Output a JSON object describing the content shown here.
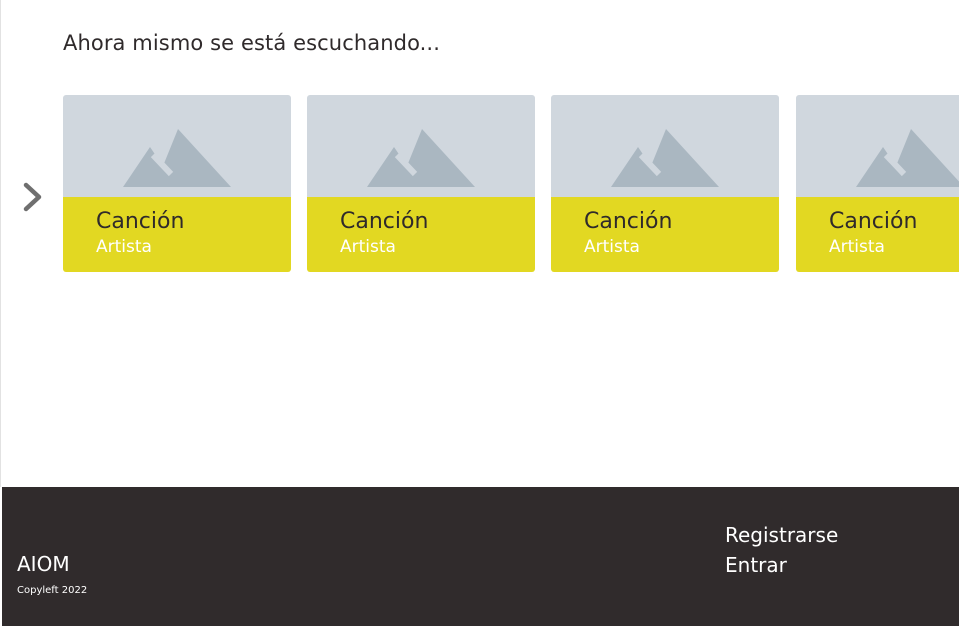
{
  "main": {
    "section_title": "Ahora mismo se está escuchando...",
    "cards": [
      {
        "song": "Canción",
        "artist": "Artista"
      },
      {
        "song": "Canción",
        "artist": "Artista"
      },
      {
        "song": "Canción",
        "artist": "Artista"
      },
      {
        "song": "Canción",
        "artist": "Artista"
      }
    ],
    "next_icon": "chevron-right-icon",
    "placeholder_icon": "image-placeholder-icon"
  },
  "footer": {
    "brand": "AIOM",
    "copyright": "Copyleft 2022",
    "links": {
      "register": "Registrarse",
      "login": "Entrar"
    }
  },
  "colors": {
    "card_image_bg": "#d0d7de",
    "card_body_bg": "#e2d822",
    "mountain": "#aab7c1",
    "footer_bg": "#302b2c",
    "text_dark": "#2f2a2b",
    "chevron": "#6f6f6f"
  }
}
